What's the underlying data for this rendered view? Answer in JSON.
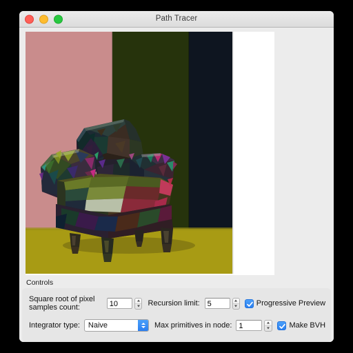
{
  "window": {
    "title": "Path Tracer",
    "traffic_lights": [
      {
        "name": "close-button",
        "color": "#ff5f57"
      },
      {
        "name": "minimize-button",
        "color": "#febc2e"
      },
      {
        "name": "maximize-button",
        "color": "#28c840"
      }
    ]
  },
  "render": {
    "scene_name": "low-poly-armchair",
    "colors": {
      "wall_left": "#c98c8c",
      "wall_mid": "#26330c",
      "wall_right": "#0e1520",
      "floor": "#a89b14",
      "canvas": "#ffffff"
    }
  },
  "controls": {
    "group_label": "Controls",
    "samples": {
      "label": "Square root of pixel samples count:",
      "value": "10",
      "stepper": "stepper"
    },
    "recursion": {
      "label": "Recursion limit:",
      "value": "5",
      "stepper": "stepper"
    },
    "progressive_preview": {
      "label": "Progressive Preview",
      "checked": true
    },
    "integrator": {
      "label": "Integrator type:",
      "value": "Naive",
      "options": [
        "Naive"
      ]
    },
    "max_primitives": {
      "label": "Max primitives in node:",
      "value": "1",
      "stepper": "stepper"
    },
    "make_bvh": {
      "label": "Make BVH",
      "checked": true
    }
  },
  "theme": {
    "accent": "#2b7ff0",
    "window_bg": "#ececec",
    "panel_bg": "#e6e6e6"
  }
}
